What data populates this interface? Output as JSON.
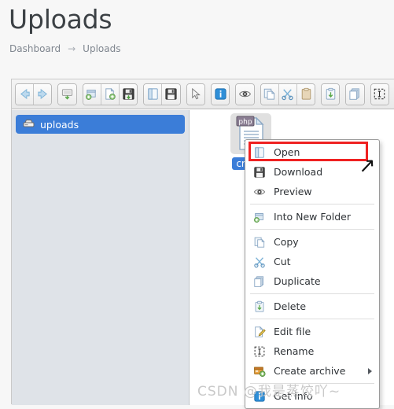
{
  "header": {
    "title": "Uploads",
    "breadcrumb": {
      "root": "Dashboard",
      "separator": "→",
      "current": "Uploads"
    }
  },
  "toolbar": {
    "groups": [
      {
        "buttons": [
          {
            "name": "back-button",
            "icon": "arrow-left-icon",
            "title": "Back"
          },
          {
            "name": "forward-button",
            "icon": "arrow-right-icon",
            "title": "Forward"
          }
        ]
      },
      {
        "buttons": [
          {
            "name": "connect-server-button",
            "icon": "server-download-icon",
            "title": "Connect"
          }
        ]
      },
      {
        "buttons": [
          {
            "name": "new-folder-button",
            "icon": "folder-add-icon",
            "title": "New Folder"
          },
          {
            "name": "new-file-button",
            "icon": "file-add-icon",
            "title": "New File"
          },
          {
            "name": "save-button",
            "icon": "floppy-save-icon",
            "title": "Save"
          }
        ]
      },
      {
        "buttons": [
          {
            "name": "open-button",
            "icon": "open-book-icon",
            "title": "Open"
          },
          {
            "name": "download-button",
            "icon": "floppy-disk-icon",
            "title": "Download"
          }
        ]
      },
      {
        "buttons": [
          {
            "name": "select-button",
            "icon": "cursor-arrow-icon",
            "title": "Select"
          }
        ]
      },
      {
        "buttons": [
          {
            "name": "get-info-button",
            "icon": "info-icon",
            "title": "Get info"
          }
        ]
      },
      {
        "buttons": [
          {
            "name": "preview-button",
            "icon": "eye-icon",
            "title": "Preview"
          }
        ]
      },
      {
        "buttons": [
          {
            "name": "copy-button",
            "icon": "copy-icon",
            "title": "Copy"
          },
          {
            "name": "cut-button",
            "icon": "scissors-icon",
            "title": "Cut"
          },
          {
            "name": "paste-button",
            "icon": "clipboard-icon",
            "title": "Paste"
          }
        ]
      },
      {
        "buttons": [
          {
            "name": "delete-button",
            "icon": "delete-icon",
            "title": "Delete"
          }
        ]
      },
      {
        "buttons": [
          {
            "name": "duplicate-button",
            "icon": "duplicate-icon",
            "title": "Duplicate"
          }
        ]
      },
      {
        "buttons": [
          {
            "name": "rename-button",
            "icon": "rename-icon",
            "title": "Rename"
          }
        ]
      }
    ]
  },
  "tree": {
    "items": [
      {
        "label": "uploads",
        "icon": "drive-icon",
        "selected": true
      }
    ]
  },
  "files": [
    {
      "name": "cmd.p",
      "type": "php",
      "badge": "php",
      "selected": true
    }
  ],
  "context_menu": {
    "items": [
      {
        "label": "Open",
        "icon": "open-book-icon",
        "separator_after": false,
        "submenu": false
      },
      {
        "label": "Download",
        "icon": "floppy-disk-icon",
        "separator_after": false,
        "submenu": false
      },
      {
        "label": "Preview",
        "icon": "eye-icon",
        "separator_after": true,
        "submenu": false
      },
      {
        "label": "Into New Folder",
        "icon": "folder-add-icon",
        "separator_after": true,
        "submenu": false
      },
      {
        "label": "Copy",
        "icon": "copy-icon",
        "separator_after": false,
        "submenu": false
      },
      {
        "label": "Cut",
        "icon": "scissors-icon",
        "separator_after": false,
        "submenu": false
      },
      {
        "label": "Duplicate",
        "icon": "duplicate-icon",
        "separator_after": true,
        "submenu": false
      },
      {
        "label": "Delete",
        "icon": "delete-icon",
        "separator_after": true,
        "submenu": false
      },
      {
        "label": "Edit file",
        "icon": "edit-file-icon",
        "separator_after": false,
        "submenu": false
      },
      {
        "label": "Rename",
        "icon": "rename-icon",
        "separator_after": false,
        "submenu": false
      },
      {
        "label": "Create archive",
        "icon": "archive-icon",
        "separator_after": true,
        "submenu": true
      },
      {
        "label": "Get info",
        "icon": "info-icon",
        "separator_after": false,
        "submenu": false
      }
    ]
  },
  "annotations": {
    "highlight_target": "Open",
    "highlight_color": "#ef2121",
    "arrow_glyph": "↗"
  },
  "watermark": "CSDN @我是蒸饺吖~",
  "colors": {
    "selection_blue": "#3b7dd8",
    "tree_background": "#dfe3e8",
    "panel_background": "#ffffff",
    "page_background": "#f7f7f7",
    "title_text": "#3c4145"
  }
}
